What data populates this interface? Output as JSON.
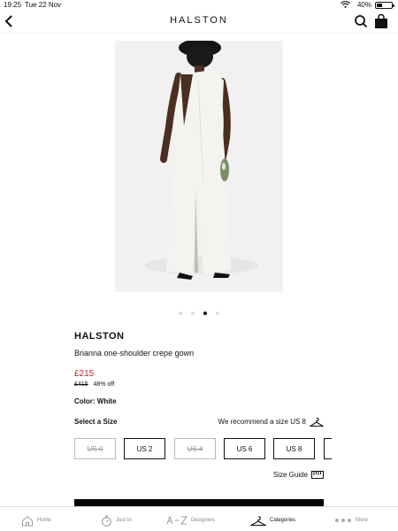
{
  "status_bar": {
    "time": "19:25",
    "date": "Tue 22 Nov",
    "battery": "40%"
  },
  "nav": {
    "brand_logo": "HALSTON",
    "icons": [
      "back-chevron-icon",
      "search-icon",
      "shopping-bag-icon"
    ]
  },
  "product": {
    "image": "woman-in-white-one-shoulder-gown",
    "gallery_count": 4,
    "gallery_active_index": 2,
    "brand": "HALSTON",
    "name": "Brianna one-shoulder crepe gown",
    "price": "£215",
    "old_price": "£415",
    "discount": "48% off",
    "color": "Color: White",
    "price_color": "#c0282d"
  },
  "sizes": {
    "label": "Select a Size",
    "recommend": "We recommend a size US 8",
    "options": [
      {
        "label": "US 0",
        "available": false
      },
      {
        "label": "US 2",
        "available": true
      },
      {
        "label": "US 4",
        "available": false
      },
      {
        "label": "US 6",
        "available": true
      },
      {
        "label": "US 8",
        "available": true
      },
      {
        "label": "",
        "available": true
      }
    ],
    "guide": "Size Guide"
  },
  "tabs": [
    {
      "label": "Home",
      "icon": "home-icon",
      "active": false
    },
    {
      "label": "Just In",
      "icon": "stopwatch-icon",
      "active": false
    },
    {
      "label": "Designers",
      "icon": "a-z-icon",
      "active": false
    },
    {
      "label": "Categories",
      "icon": "hanger-icon",
      "active": true
    },
    {
      "label": "More",
      "icon": "more-dots-icon",
      "active": false
    }
  ]
}
